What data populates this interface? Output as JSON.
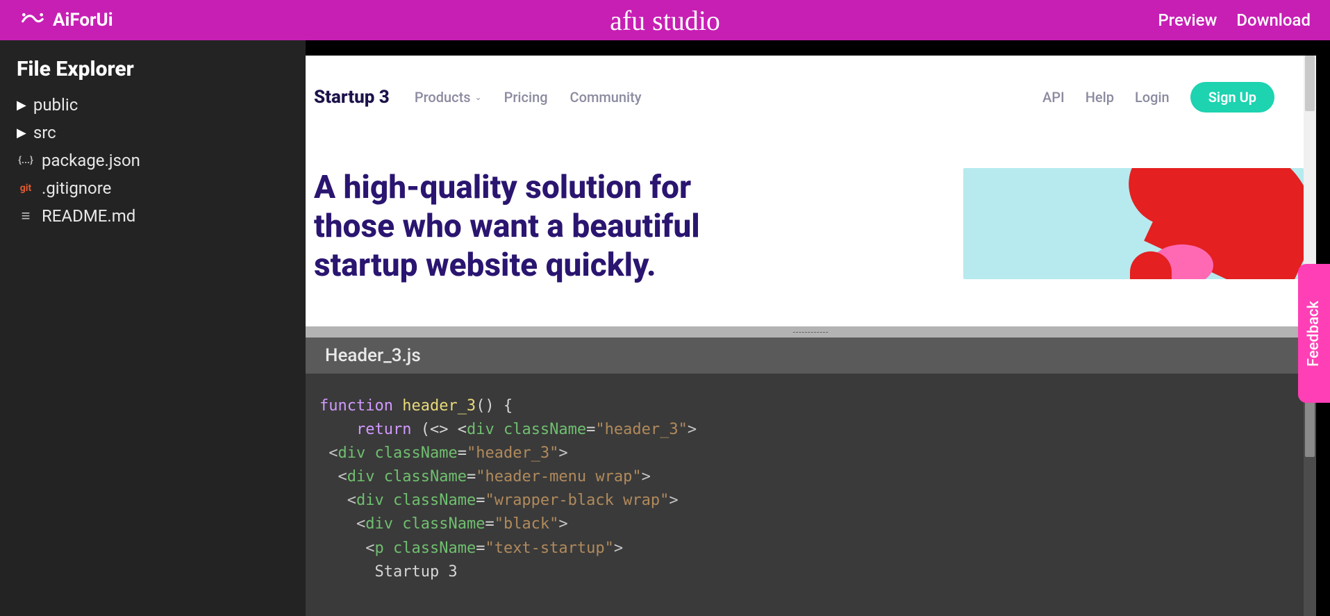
{
  "topbar": {
    "brand": "AiForUi",
    "center": "afu studio",
    "preview": "Preview",
    "download": "Download"
  },
  "sidebar": {
    "title": "File Explorer",
    "folders": [
      {
        "name": "public"
      },
      {
        "name": "src"
      }
    ],
    "files": [
      {
        "name": "package.json",
        "iconText": "{...}",
        "iconColor": "#bfbfbf"
      },
      {
        "name": ".gitignore",
        "iconText": "git",
        "iconColor": "#e25b2f"
      },
      {
        "name": "README.md",
        "iconText": "≡",
        "iconColor": "#bfbfbf"
      }
    ]
  },
  "preview": {
    "brand": "Startup 3",
    "menu": [
      {
        "label": "Products",
        "dropdown": true
      },
      {
        "label": "Pricing",
        "dropdown": false
      },
      {
        "label": "Community",
        "dropdown": false
      }
    ],
    "links": [
      {
        "label": "API"
      },
      {
        "label": "Help"
      },
      {
        "label": "Login"
      }
    ],
    "signup": "Sign Up",
    "headline": "A high-quality solution for those who want a beautiful startup website quickly."
  },
  "splitter": {
    "dashes": "------------"
  },
  "editor": {
    "tab": "Header_3.js",
    "code": {
      "l1_kw": "function",
      "l1_fn": "header_3",
      "l1_rest": "() {",
      "l2_kw": "return",
      "l2_a": " (<> <",
      "l2_tag": "div",
      "l2_sp": " ",
      "l2_attr": "className",
      "l2_eq": "=",
      "l2_str": "\"header_3\"",
      "l2_close": ">",
      "l3_open": " <",
      "l3_tag": "div",
      "l3_attr": "className",
      "l3_eq": "=",
      "l3_str": "\"header_3\"",
      "l3_close": ">",
      "l4_open": "  <",
      "l4_tag": "div",
      "l4_attr": "className",
      "l4_eq": "=",
      "l4_str": "\"header-menu wrap\"",
      "l4_close": ">",
      "l5_open": "   <",
      "l5_tag": "div",
      "l5_attr": "className",
      "l5_eq": "=",
      "l5_str": "\"wrapper-black wrap\"",
      "l5_close": ">",
      "l6_open": "    <",
      "l6_tag": "div",
      "l6_attr": "className",
      "l6_eq": "=",
      "l6_str": "\"black\"",
      "l6_close": ">",
      "l7_open": "     <",
      "l7_tag": "p",
      "l7_attr": "className",
      "l7_eq": "=",
      "l7_str": "\"text-startup\"",
      "l7_close": ">",
      "l8_text": "      Startup 3"
    }
  },
  "feedback": {
    "label": "Feedback"
  }
}
